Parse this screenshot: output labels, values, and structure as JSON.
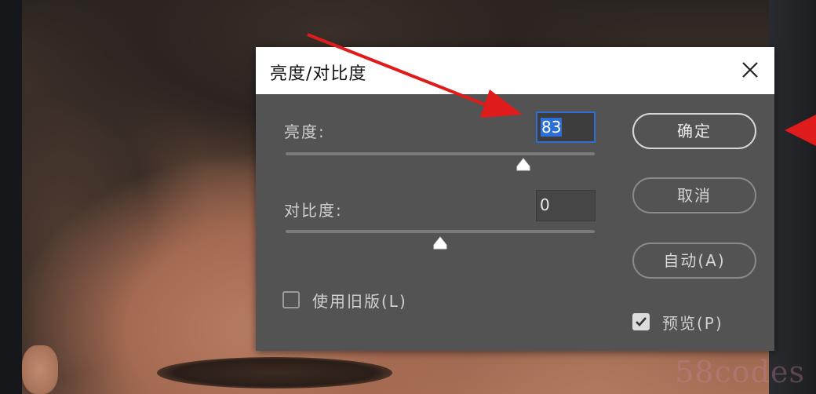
{
  "dialog": {
    "title": "亮度/对比度",
    "brightness": {
      "label": "亮度:",
      "value": "83",
      "slider_fraction": 0.77
    },
    "contrast": {
      "label": "对比度:",
      "value": "0",
      "slider_fraction": 0.5
    },
    "legacy": {
      "label": "使用旧版(L)",
      "checked": false
    },
    "buttons": {
      "ok": "确定",
      "cancel": "取消",
      "auto": "自动(A)"
    },
    "preview": {
      "label": "预览(P)",
      "checked": true
    }
  },
  "watermark": "58codes",
  "colors": {
    "dialog_bg": "#535353",
    "titlebar_bg": "#ffffff",
    "focus_blue": "#2f6fd1",
    "annotation_red": "#e01b1b"
  }
}
